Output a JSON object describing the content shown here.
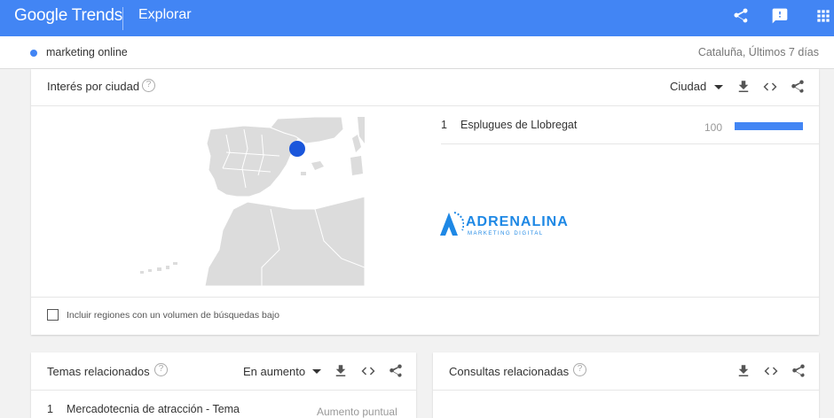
{
  "header": {
    "logo": "Google Trends",
    "section": "Explorar"
  },
  "term": {
    "label": "marketing online",
    "region": "Cataluña, Últimos 7 días",
    "color": "#4285f4"
  },
  "interest_by_city": {
    "title": "Interés por ciudad",
    "resolution": "Ciudad",
    "rows": [
      {
        "rank": "1",
        "city": "Esplugues de Llobregat",
        "value": "100"
      }
    ],
    "checkbox_label": "Incluir regiones con un volumen de búsquedas bajo"
  },
  "watermark": {
    "brand": "ADRENALINA",
    "tagline": "MARKETING DIGITAL"
  },
  "related_topics": {
    "title": "Temas relacionados",
    "filter": "En aumento",
    "rows": [
      {
        "rank": "1",
        "name": "Mercadotecnia de atracción - Tema",
        "value": "Aumento puntual"
      }
    ]
  },
  "related_queries": {
    "title": "Consultas relacionadas"
  },
  "colors": {
    "accent": "#4285f4",
    "marker": "#1a56db"
  }
}
